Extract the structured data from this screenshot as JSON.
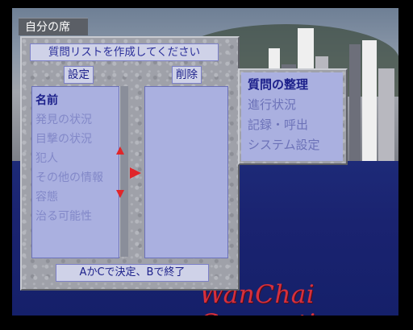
{
  "tab": {
    "label": "自分の席"
  },
  "panel": {
    "title": "質問リストを作成してください",
    "settings_label": "設定",
    "delete_label": "削除",
    "footer": "AかCで決定、Bで終了"
  },
  "left_list": {
    "items": [
      {
        "label": "名前",
        "active": true
      },
      {
        "label": "発見の状況",
        "active": false
      },
      {
        "label": "目撃の状況",
        "active": false
      },
      {
        "label": "犯人",
        "active": false
      },
      {
        "label": "その他の情報",
        "active": false
      },
      {
        "label": "容態",
        "active": false
      },
      {
        "label": "治る可能性",
        "active": false
      }
    ]
  },
  "side_menu": {
    "items": [
      {
        "label": "質問の整理",
        "active": true
      },
      {
        "label": "進行状況",
        "active": false
      },
      {
        "label": "記録・呼出",
        "active": false
      },
      {
        "label": "システム設定",
        "active": false
      }
    ]
  },
  "brand": {
    "text": "WanChai Connection"
  },
  "colors": {
    "accent_red": "#e0262a",
    "list_bg": "#aab0e0",
    "text_blue": "#1b1f8a"
  }
}
